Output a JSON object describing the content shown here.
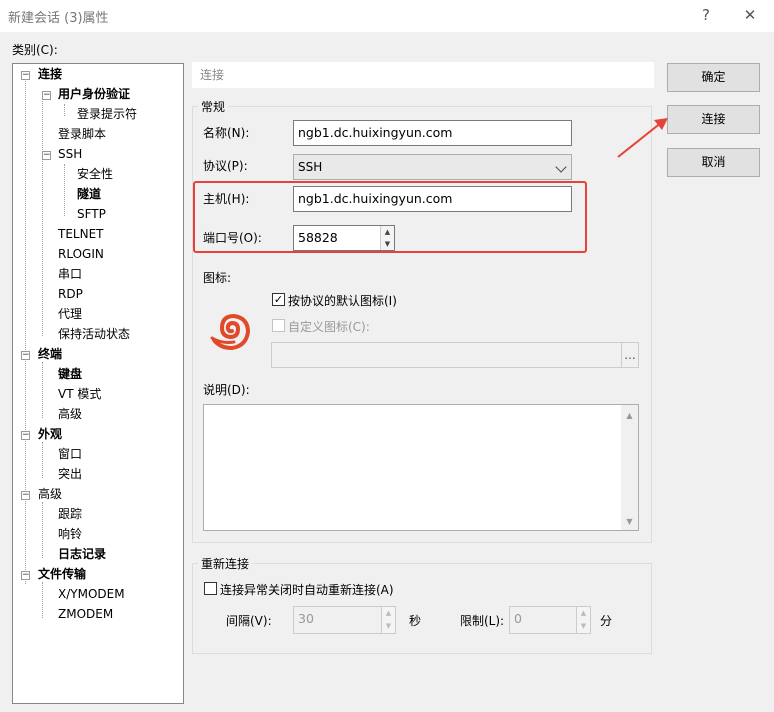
{
  "window": {
    "title": "新建会话 (3)属性",
    "help_glyph": "?",
    "close_glyph": "✕"
  },
  "category": {
    "label": "类别(C):"
  },
  "tree": {
    "connection": "连接",
    "user_auth": "用户身份验证",
    "login_prompt": "登录提示符",
    "login_script": "登录脚本",
    "ssh": "SSH",
    "security": "安全性",
    "tunnel": "隧道",
    "sftp": "SFTP",
    "telnet": "TELNET",
    "rlogin": "RLOGIN",
    "serial": "串口",
    "rdp": "RDP",
    "proxy": "代理",
    "keepalive": "保持活动状态",
    "terminal": "终端",
    "keyboard": "键盘",
    "vt_mode": "VT 模式",
    "terminal_advanced": "高级",
    "appearance": "外观",
    "window": "窗口",
    "highlight": "突出",
    "advanced": "高级",
    "trace": "跟踪",
    "bell": "响铃",
    "logging": "日志记录",
    "file_transfer": "文件传输",
    "xymodem": "X/YMODEM",
    "zmodem": "ZMODEM"
  },
  "section": {
    "header": "连接"
  },
  "general": {
    "title": "常规",
    "name_label": "名称(N):",
    "name_value": "ngb1.dc.huixingyun.com",
    "protocol_label": "协议(P):",
    "protocol_value": "SSH",
    "host_label": "主机(H):",
    "host_value": "ngb1.dc.huixingyun.com",
    "port_label": "端口号(O):",
    "port_value": "58828"
  },
  "icon": {
    "label": "图标:",
    "default_label": "按协议的默认图标(I)",
    "custom_label": "自定义图标(C):",
    "browse_label": "..."
  },
  "description": {
    "label": "说明(D):"
  },
  "reconnect": {
    "title": "重新连接",
    "auto_label": "连接异常关闭时自动重新连接(A)",
    "interval_label": "间隔(V):",
    "interval_value": "30",
    "interval_unit": "秒",
    "limit_label": "限制(L):",
    "limit_value": "0",
    "limit_unit": "分"
  },
  "buttons": {
    "ok": "确定",
    "connect": "连接",
    "cancel": "取消"
  },
  "colors": {
    "highlight_box": "#e8413b",
    "arrow": "#e8413b",
    "app_icon": "#e04a2a"
  }
}
